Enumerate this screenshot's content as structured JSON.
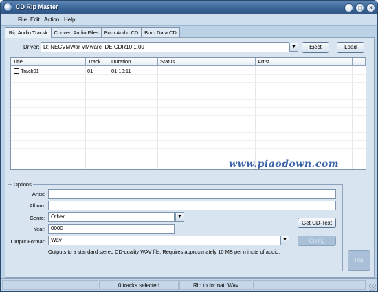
{
  "window": {
    "title": "CD Rip Master",
    "controls": {
      "minimize": "–",
      "maximize": "□",
      "close": "×"
    }
  },
  "menu": [
    "File",
    "Edit",
    "Action",
    "Help"
  ],
  "tabs": [
    {
      "label": "Rip Audio Tracsk",
      "active": true
    },
    {
      "label": "Convert Audio Files",
      "active": false
    },
    {
      "label": "Burn Audio CD",
      "active": false
    },
    {
      "label": "Burn Data CD",
      "active": false
    }
  ],
  "driver": {
    "label": "Driver:",
    "value": "D: NECVMWar VMware IDE CDR10 1.00",
    "eject_label": "Eject",
    "load_label": "Load"
  },
  "track_table": {
    "columns": [
      "Title",
      "Track",
      "Duration",
      "Status",
      "Artist"
    ],
    "rows": [
      {
        "title": "Track01",
        "track": "01",
        "duration": "01:10:11",
        "status": "",
        "artist": "",
        "checked": false
      }
    ]
  },
  "watermark": "www.piaodown.com",
  "options": {
    "legend": "Options",
    "artist_label": "Artist:",
    "artist_value": "",
    "album_label": "Album:",
    "album_value": "",
    "genre_label": "Genre:",
    "genre_value": "Other",
    "year_label": "Year:",
    "year_value": "0000",
    "format_label": "Output Format:",
    "format_value": "Wav",
    "get_cd_text_label": "Get CD-Text",
    "config_label": "Config",
    "hint": "Outputs to a standard stereo CD-quality WAV file.  Requires approximately 10 MB per minute of audio."
  },
  "rip_label": "Rip",
  "statusbar": {
    "tracks": "0 tracks selected",
    "format": "Rip to format: Wav"
  },
  "colors": {
    "titlebar": "#3a6496",
    "panel": "#d8e5f1",
    "watermark": "#3a63a8"
  }
}
